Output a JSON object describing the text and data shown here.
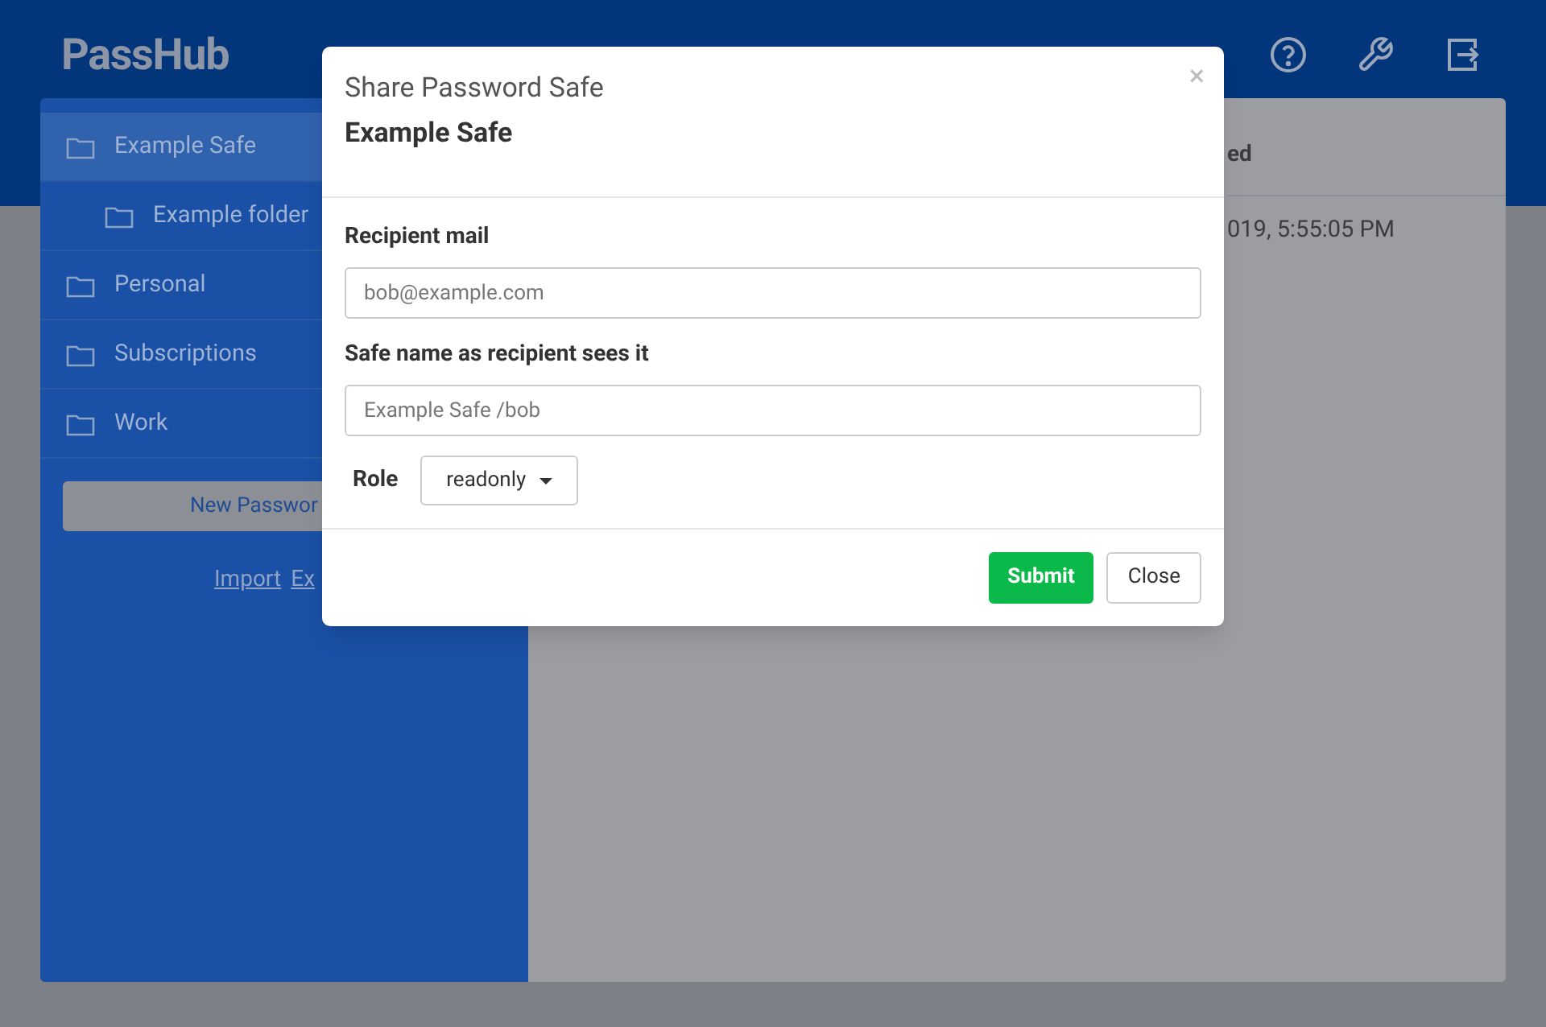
{
  "header": {
    "logo": "PassHub"
  },
  "sidebar": {
    "items": [
      {
        "label": "Example Safe",
        "selected": true,
        "children": [
          {
            "label": "Example folder",
            "selected": false
          }
        ]
      },
      {
        "label": "Personal",
        "selected": false
      },
      {
        "label": "Subscriptions",
        "selected": false
      },
      {
        "label": "Work",
        "selected": false
      }
    ],
    "new_button": "New Passwor",
    "links": [
      "Import",
      "Ex"
    ]
  },
  "table": {
    "column_header": "ed",
    "rows": [
      "019, 5:55:05 PM"
    ]
  },
  "dialog": {
    "title": "Share Password Safe",
    "subtitle": "Example Safe",
    "close": "×",
    "fields": [
      {
        "label": "Recipient mail",
        "placeholder": "bob@example.com"
      },
      {
        "label": "Safe name as recipient sees it",
        "placeholder": "Example Safe /bob"
      }
    ],
    "role": {
      "label": "Role",
      "value": "readonly"
    },
    "buttons": [
      {
        "label": "Submit",
        "kind": "primary"
      },
      {
        "label": "Close",
        "kind": "secondary"
      }
    ]
  }
}
